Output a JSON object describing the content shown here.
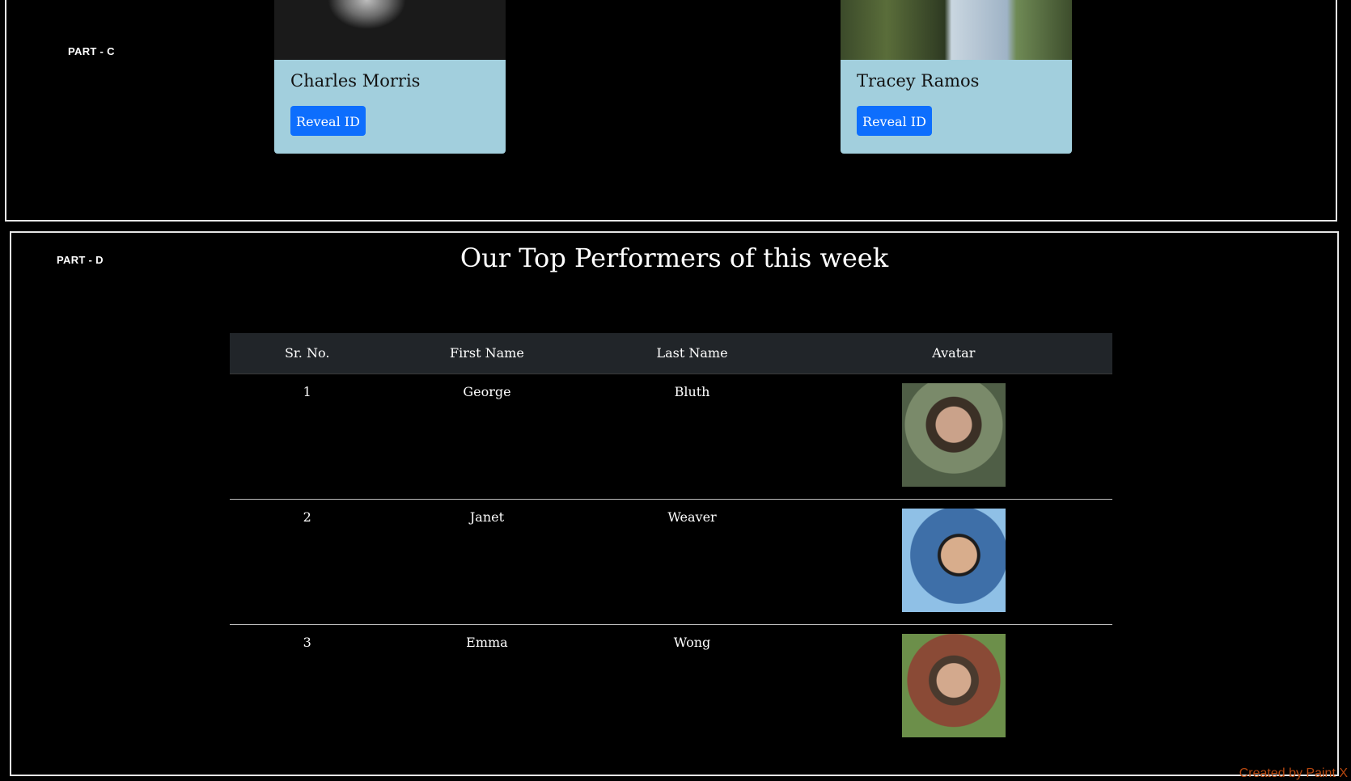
{
  "part_c": {
    "label": "PART - C",
    "cards": [
      {
        "name": "Charles Morris",
        "button_label": "Reveal ID"
      },
      {
        "name": "Tracey Ramos",
        "button_label": "Reveal ID"
      }
    ]
  },
  "part_d": {
    "label": "PART - D",
    "title": "Our Top Performers of this week",
    "table": {
      "headers": [
        "Sr. No.",
        "First Name",
        "Last Name",
        "Avatar"
      ],
      "rows": [
        {
          "sr": "1",
          "first": "George",
          "last": "Bluth"
        },
        {
          "sr": "2",
          "first": "Janet",
          "last": "Weaver"
        },
        {
          "sr": "3",
          "first": "Emma",
          "last": "Wong"
        }
      ]
    }
  },
  "footer": {
    "credit": "Created by Paint X"
  },
  "colors": {
    "background": "#000000",
    "card_background": "#a2cfdd",
    "button": "#0d6efd",
    "table_header": "#212529",
    "credit": "#b5470f"
  }
}
